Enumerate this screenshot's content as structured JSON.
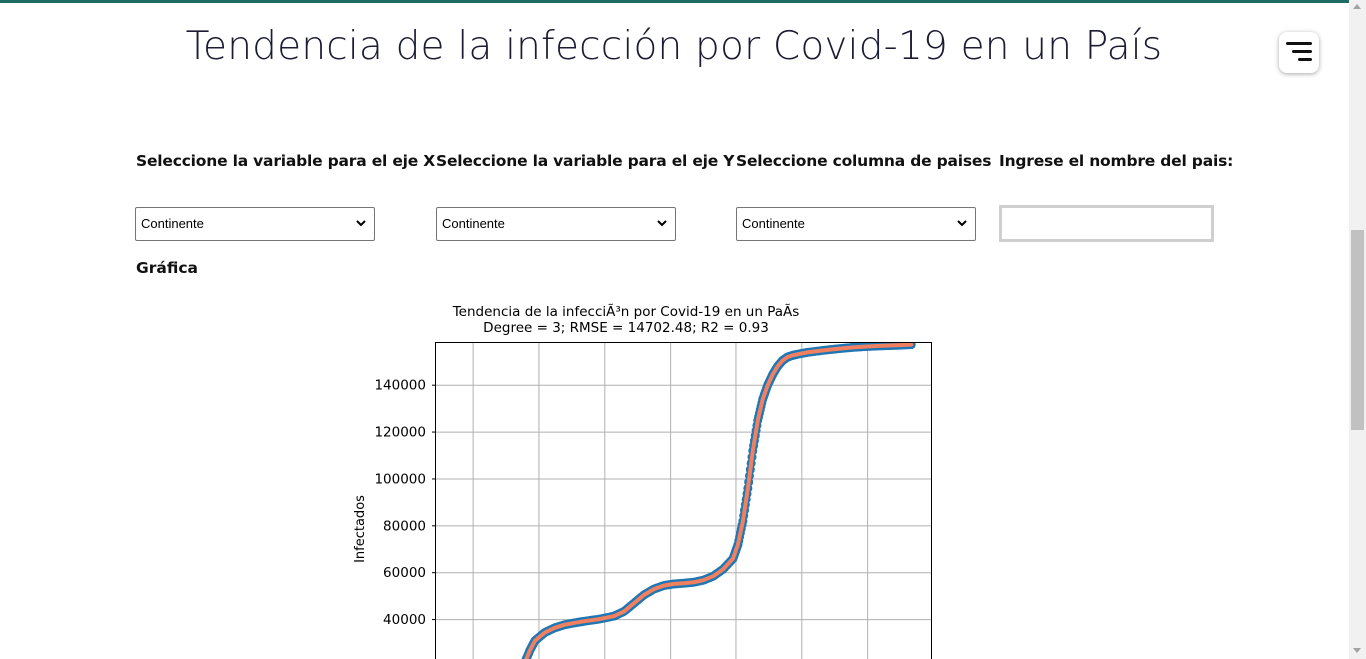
{
  "page": {
    "title": "Tendencia de la infección por Covid-19 en un País"
  },
  "controls": {
    "x_label": "Seleccione la variable para el eje X",
    "y_label": "Seleccione la variable para el eje Y",
    "country_col_label": "Seleccione columna de paises",
    "country_name_label": "Ingrese el nombre del pais:",
    "x_select_value": "Continente",
    "y_select_value": "Continente",
    "country_col_value": "Continente",
    "country_name_value": ""
  },
  "section": {
    "graph_label": "Gráfica"
  },
  "icons": {
    "menu": "menu-icon",
    "dropdown": "chevron-down-icon"
  },
  "colors": {
    "accent": "#1f6b63",
    "data_points": "#1f77b4",
    "fit_line": "#f08060"
  },
  "chart_data": {
    "type": "scatter",
    "title": "Tendencia de la infecciÃ³n por Covid-19 en un PaÃ­s",
    "subtitle": "Degree = 3; RMSE = 14702.48; R2 = 0.93",
    "ylabel": "Infectados",
    "xlabel": "",
    "y_ticks": [
      40000,
      60000,
      80000,
      100000,
      120000,
      140000
    ],
    "y_tick_labels": [
      "40000",
      "60000",
      "80000",
      "100000",
      "120000",
      "140000"
    ],
    "ylim": [
      22000,
      158000
    ],
    "xlim": [
      0,
      100
    ],
    "x_gridlines": [
      7.5,
      20.8,
      34.1,
      47.4,
      60.6,
      73.9,
      87.2
    ],
    "grid": true,
    "series": [
      {
        "role": "data",
        "x": [
          18,
          19,
          20,
          22,
          24,
          26,
          28,
          30,
          33,
          36,
          38,
          40,
          42,
          44,
          46,
          48,
          50,
          52,
          54,
          56,
          58,
          60,
          61,
          62,
          63,
          64,
          65,
          66,
          67,
          68,
          69,
          70,
          71,
          72,
          73,
          75,
          78,
          81,
          84,
          87,
          90,
          93,
          96
        ],
        "y": [
          22000,
          27000,
          31000,
          34500,
          36500,
          37800,
          38600,
          39300,
          40200,
          41500,
          43500,
          47000,
          50500,
          53000,
          54500,
          55200,
          55500,
          55900,
          56800,
          58500,
          61500,
          66000,
          72000,
          82000,
          96000,
          112000,
          125000,
          134000,
          140000,
          144500,
          148000,
          150500,
          152000,
          152700,
          153200,
          154000,
          154800,
          155500,
          156100,
          156500,
          156800,
          157000,
          157300
        ]
      }
    ]
  }
}
